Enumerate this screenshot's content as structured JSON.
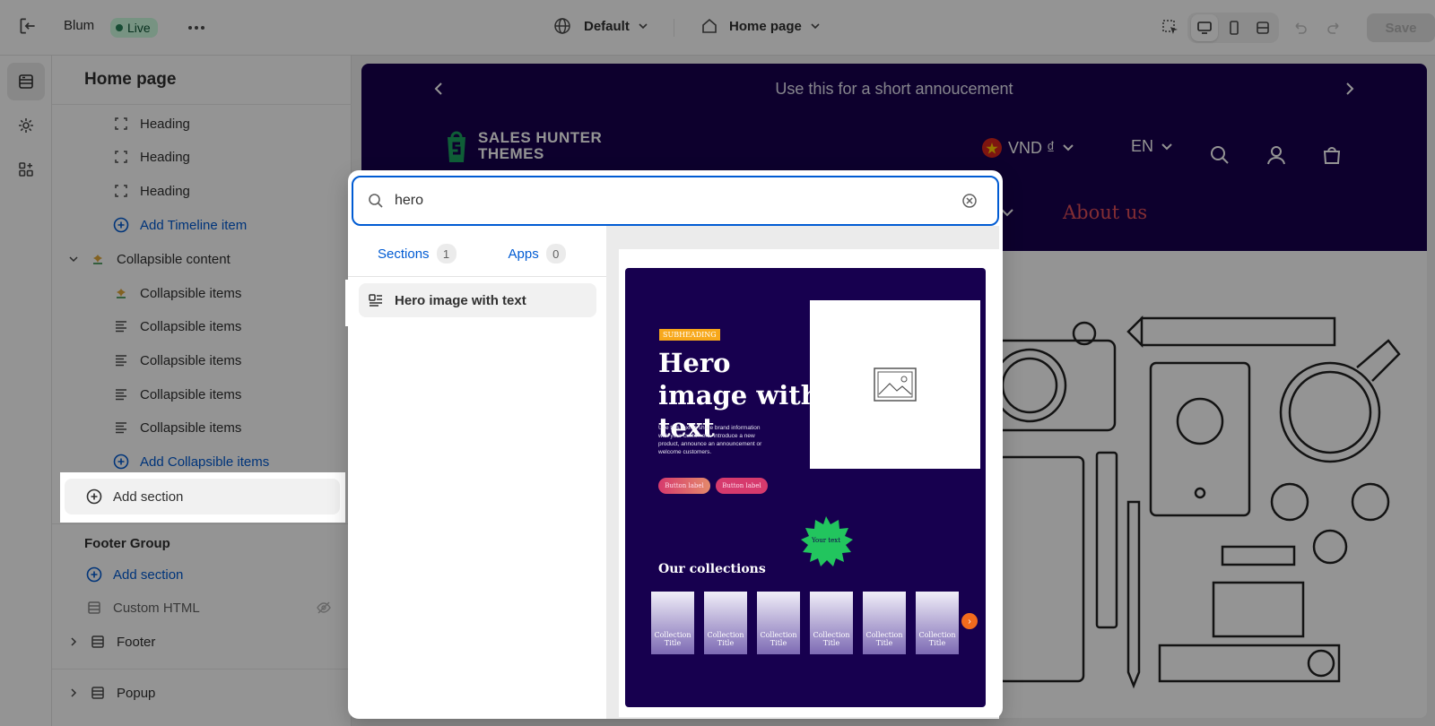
{
  "topbar": {
    "store_name": "Blum",
    "live_label": "Live",
    "theme_select": "Default",
    "page_select": "Home page",
    "save_label": "Save"
  },
  "sidebar": {
    "title": "Home page",
    "items": [
      {
        "label": "Heading",
        "icon": "dashed-square-icon"
      },
      {
        "label": "Heading",
        "icon": "dashed-square-icon"
      },
      {
        "label": "Heading",
        "icon": "dashed-square-icon"
      },
      {
        "label": "Add Timeline item",
        "icon": "plus-circle-icon"
      },
      {
        "label": "Collapsible content",
        "icon": "app-block-icon"
      },
      {
        "label": "Collapsible items",
        "icon": "app-block-icon"
      },
      {
        "label": "Collapsible items",
        "icon": "text-lines-icon"
      },
      {
        "label": "Collapsible items",
        "icon": "text-lines-icon"
      },
      {
        "label": "Collapsible items",
        "icon": "text-lines-icon"
      },
      {
        "label": "Collapsible items",
        "icon": "text-lines-icon"
      },
      {
        "label": "Add Collapsible items",
        "icon": "plus-circle-icon"
      }
    ],
    "add_section": "Add section",
    "footer_group": {
      "title": "Footer Group",
      "add_section": "Add section",
      "custom_html": "Custom HTML",
      "footer": "Footer"
    },
    "popup": "Popup"
  },
  "site": {
    "announcement": "Use this for a short annoucement",
    "logo_line1": "SALES HUNTER",
    "logo_line2": "THEMES",
    "currency": "VND ₫",
    "language": "EN",
    "nav_about": "About us",
    "colors": {
      "header_bg": "#17004f",
      "accent": "#e04e59"
    }
  },
  "picker": {
    "search_value": "hero",
    "tabs": [
      {
        "label": "Sections",
        "count": "1"
      },
      {
        "label": "Apps",
        "count": "0"
      }
    ],
    "result": "Hero image with text",
    "preview": {
      "subheading": "SUBHEADING",
      "title": "Hero image with text",
      "body": "Use this text to share brand information with your customers. Introduce a new product, announce an announcement or welcome customers.",
      "button1": "Button label",
      "button2": "Button label",
      "badge": "Your text",
      "collections_title": "Our collections",
      "tile_label": "Collection Title"
    }
  }
}
